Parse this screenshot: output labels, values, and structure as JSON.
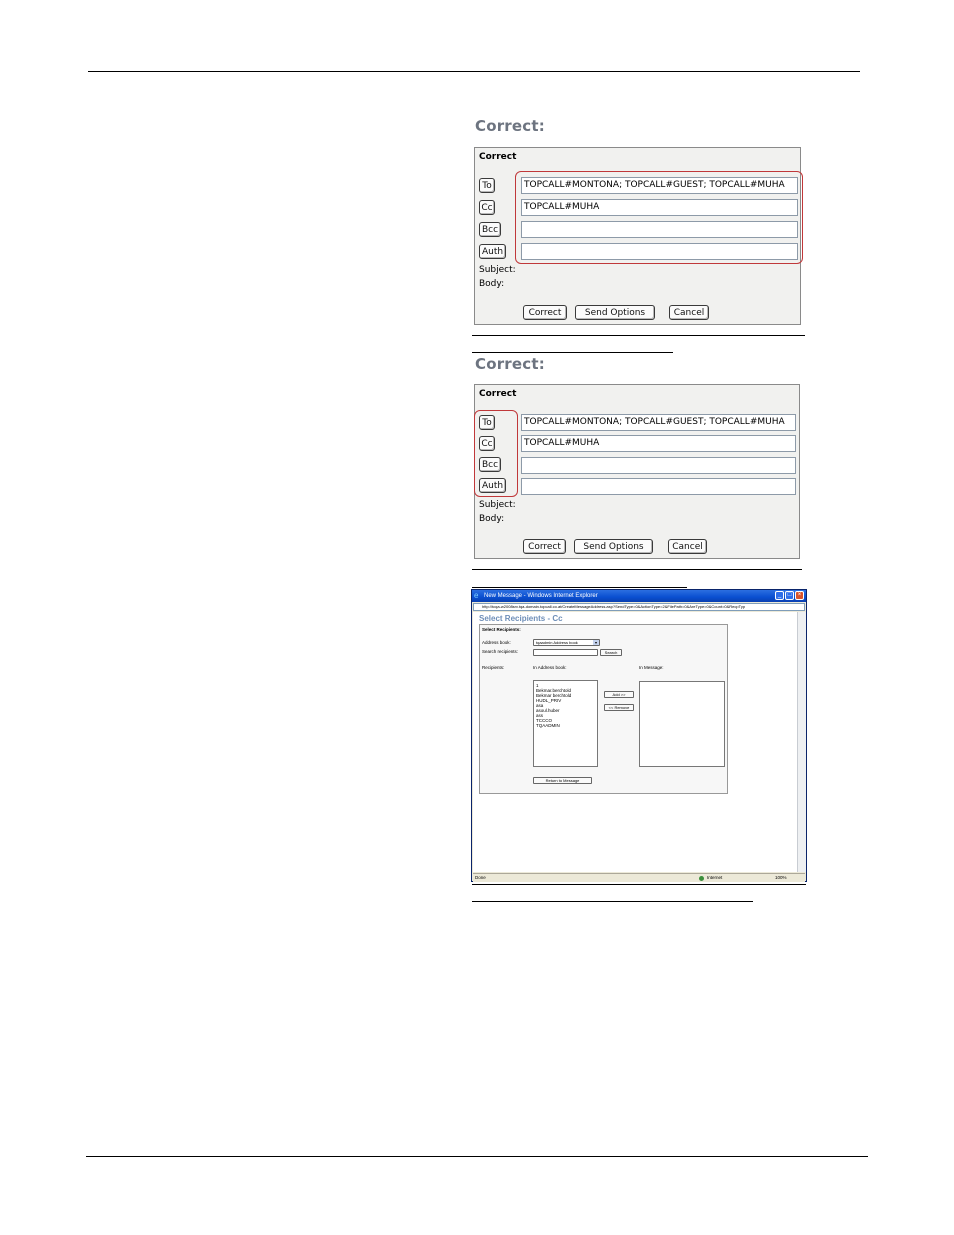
{
  "figure1": {
    "heading": "Correct:",
    "panel_title": "Correct",
    "buttons": {
      "to": "To",
      "cc": "Cc",
      "bcc": "Bcc",
      "auth": "Auth"
    },
    "fields": {
      "to": "TOPCALL#MONTONA; TOPCALL#GUEST; TOPCALL#MUHA",
      "cc": "TOPCALL#MUHA",
      "bcc": "",
      "auth": ""
    },
    "subject_label": "Subject:",
    "body_label": "Body:",
    "actions": {
      "correct": "Correct",
      "send_options": "Send Options",
      "cancel": "Cancel"
    },
    "highlight": "input fields"
  },
  "figure2": {
    "heading": "Correct:",
    "panel_title": "Correct",
    "buttons": {
      "to": "To",
      "cc": "Cc",
      "bcc": "Bcc",
      "auth": "Auth"
    },
    "fields": {
      "to": "TOPCALL#MONTONA; TOPCALL#GUEST; TOPCALL#MUHA",
      "cc": "TOPCALL#MUHA",
      "bcc": "",
      "auth": ""
    },
    "subject_label": "Subject:",
    "body_label": "Body:",
    "actions": {
      "correct": "Correct",
      "send_options": "Send Options",
      "cancel": "Cancel"
    },
    "highlight": "address buttons"
  },
  "browser": {
    "window_title": "New Message - Windows Internet Explorer",
    "address_url": "http://tcqa-w2008srv.tqa-domain.topcall.co.at/CreateMessageAddress.asp?SendType=0&ActionType=2&FilePath=0&AreType=0&Count=0&RecpTyp",
    "page_title": "Select Recipients - Cc",
    "box_title": "Select Recipients:",
    "address_book_label": "Address book:",
    "address_book_value": "tqaadmin Address book",
    "search_label": "Search recipients:",
    "search_value": "",
    "search_button": "Search",
    "recipients_label": "Recipients:",
    "in_address_book_label": "In Address book:",
    "in_message_label": "In Message:",
    "address_book_entries": [
      "1",
      "Bekmar.berchtold",
      "Bekmar berchtold",
      "HUDL_PRIV",
      "asa",
      "asoul.huber",
      "ass",
      "TCCCO",
      "TQAADMIN"
    ],
    "add_button": "Add >>",
    "remove_button": "<< Remove",
    "return_button": "Return to Message",
    "status_left": "Done",
    "status_zone": "Internet",
    "status_zoom": "100%"
  },
  "colors": {
    "highlight_red": "#c0383a",
    "heading_gray": "#6d7480",
    "panel_bg": "#f1f1ef",
    "xp_title_blue": "#0a4fd1"
  }
}
